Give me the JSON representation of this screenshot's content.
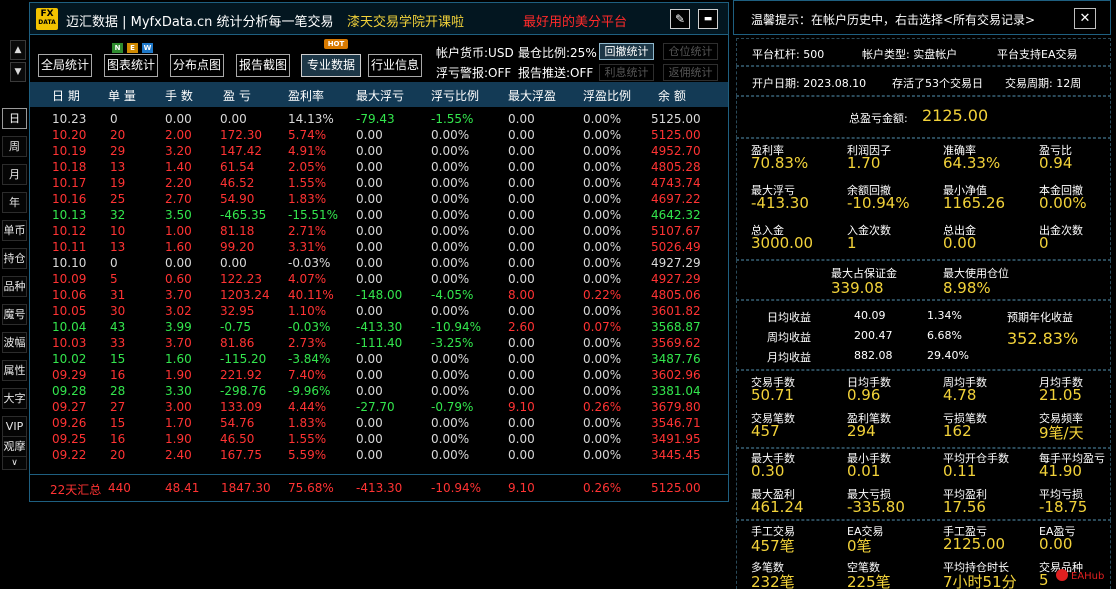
{
  "left_strip": {
    "up_arrow": "▲",
    "down_arrow": "▼",
    "buttons": [
      "日",
      "周",
      "月",
      "年",
      "单币",
      "持仓",
      "品种",
      "魔号",
      "波幅",
      "属性",
      "大字",
      "VIP",
      "观摩"
    ],
    "chevron": "∨",
    "selected": "日"
  },
  "app": {
    "logo_top": "FX",
    "logo_bottom": "DATA",
    "title": "迈汇数据 | MyfxData.cn  统计分析每一笔交易",
    "promo1": "漆天交易学院开课啦",
    "promo2": "最好用的美分平台",
    "edit_icon": "✎",
    "minimize_icon": "▬"
  },
  "toolbar": {
    "badge_new": [
      "N",
      "E",
      "W"
    ],
    "badge_new_colors": [
      "#2e8b2e",
      "#d08a00",
      "#1d77c8"
    ],
    "badge_hot": "HOT",
    "buttons": [
      "全局统计",
      "图表统计",
      "分布点图",
      "报告截图",
      "专业数据",
      "行业信息"
    ],
    "active": "专业数据",
    "currency": "帐户货币:USD",
    "max_position_ratio": "最仓比例:25%",
    "float_alert": "浮亏警报:OFF",
    "report_push": "报告推送:OFF",
    "small_buttons": [
      "回撤统计",
      "仓位统计",
      "利息统计",
      "返佣统计"
    ]
  },
  "table": {
    "headers": [
      "日 期",
      "单 量",
      "手 数",
      "盈 亏",
      "盈利率",
      "最大浮亏",
      "浮亏比例",
      "最大浮盈",
      "浮盈比例",
      "余 额"
    ],
    "rows": [
      [
        "10.23",
        "0",
        "0.00",
        "0.00",
        "14.13%",
        "-79.43",
        "-1.55%",
        "0.00",
        "0.00%",
        "5125.00"
      ],
      [
        "10.20",
        "20",
        "2.00",
        "172.30",
        "5.74%",
        "0.00",
        "0.00%",
        "0.00",
        "0.00%",
        "5125.00"
      ],
      [
        "10.19",
        "29",
        "3.20",
        "147.42",
        "4.91%",
        "0.00",
        "0.00%",
        "0.00",
        "0.00%",
        "4952.70"
      ],
      [
        "10.18",
        "13",
        "1.40",
        "61.54",
        "2.05%",
        "0.00",
        "0.00%",
        "0.00",
        "0.00%",
        "4805.28"
      ],
      [
        "10.17",
        "19",
        "2.20",
        "46.52",
        "1.55%",
        "0.00",
        "0.00%",
        "0.00",
        "0.00%",
        "4743.74"
      ],
      [
        "10.16",
        "25",
        "2.70",
        "54.90",
        "1.83%",
        "0.00",
        "0.00%",
        "0.00",
        "0.00%",
        "4697.22"
      ],
      [
        "10.13",
        "32",
        "3.50",
        "-465.35",
        "-15.51%",
        "0.00",
        "0.00%",
        "0.00",
        "0.00%",
        "4642.32"
      ],
      [
        "10.12",
        "10",
        "1.00",
        "81.18",
        "2.71%",
        "0.00",
        "0.00%",
        "0.00",
        "0.00%",
        "5107.67"
      ],
      [
        "10.11",
        "13",
        "1.60",
        "99.20",
        "3.31%",
        "0.00",
        "0.00%",
        "0.00",
        "0.00%",
        "5026.49"
      ],
      [
        "10.10",
        "0",
        "0.00",
        "0.00",
        "-0.03%",
        "0.00",
        "0.00%",
        "0.00",
        "0.00%",
        "4927.29"
      ],
      [
        "10.09",
        "5",
        "0.60",
        "122.23",
        "4.07%",
        "0.00",
        "0.00%",
        "0.00",
        "0.00%",
        "4927.29"
      ],
      [
        "10.06",
        "31",
        "3.70",
        "1203.24",
        "40.11%",
        "-148.00",
        "-4.05%",
        "8.00",
        "0.22%",
        "4805.06"
      ],
      [
        "10.05",
        "30",
        "3.02",
        "32.95",
        "1.10%",
        "0.00",
        "0.00%",
        "0.00",
        "0.00%",
        "3601.82"
      ],
      [
        "10.04",
        "43",
        "3.99",
        "-0.75",
        "-0.03%",
        "-413.30",
        "-10.94%",
        "2.60",
        "0.07%",
        "3568.87"
      ],
      [
        "10.03",
        "33",
        "3.70",
        "81.86",
        "2.73%",
        "-111.40",
        "-3.25%",
        "0.00",
        "0.00%",
        "3569.62"
      ],
      [
        "10.02",
        "15",
        "1.60",
        "-115.20",
        "-3.84%",
        "0.00",
        "0.00%",
        "0.00",
        "0.00%",
        "3487.76"
      ],
      [
        "09.29",
        "16",
        "1.90",
        "221.92",
        "7.40%",
        "0.00",
        "0.00%",
        "0.00",
        "0.00%",
        "3602.96"
      ],
      [
        "09.28",
        "28",
        "3.30",
        "-298.76",
        "-9.96%",
        "0.00",
        "0.00%",
        "0.00",
        "0.00%",
        "3381.04"
      ],
      [
        "09.27",
        "27",
        "3.00",
        "133.09",
        "4.44%",
        "-27.70",
        "-0.79%",
        "9.10",
        "0.26%",
        "3679.80"
      ],
      [
        "09.26",
        "15",
        "1.70",
        "54.76",
        "1.83%",
        "0.00",
        "0.00%",
        "0.00",
        "0.00%",
        "3546.71"
      ],
      [
        "09.25",
        "16",
        "1.90",
        "46.50",
        "1.55%",
        "0.00",
        "0.00%",
        "0.00",
        "0.00%",
        "3491.95"
      ],
      [
        "09.22",
        "20",
        "2.40",
        "167.75",
        "5.59%",
        "0.00",
        "0.00%",
        "0.00",
        "0.00%",
        "3445.45"
      ]
    ],
    "row_colors": [
      "#d9d9d9",
      "#ff3333",
      "#ff3333",
      "#ff3333",
      "#ff3333",
      "#ff3333",
      "#33e64d",
      "#ff3333",
      "#ff3333",
      "#d9d9d9",
      "#ff3333",
      "#ff3333",
      "#ff3333",
      "#33e64d",
      "#ff3333",
      "#33e64d",
      "#ff3333",
      "#33e64d",
      "#ff3333",
      "#ff3333",
      "#ff3333",
      "#ff3333"
    ],
    "summary": [
      "22天汇总",
      "440",
      "48.41",
      "1847.30",
      "75.68%",
      "-413.30",
      "-10.94%",
      "9.10",
      "0.26%",
      "5125.00"
    ]
  },
  "colors": {
    "profit": "#ff3333",
    "loss": "#33e64d",
    "neutral": "#d9d9d9",
    "accent": "#f2d23a",
    "zero": "#d9d9d9",
    "max_float_loss": "#33e64d"
  },
  "right": {
    "notice": "温馨提示：在帐户历史中，右击选择<所有交易记录>",
    "close_icon": "✕",
    "account": {
      "leverage": "平台杠杆:  500",
      "type": "帐户类型:  实盘帐户",
      "ea": "平台支持EA交易",
      "open_date": "开户日期:  2023.08.10",
      "days": "存活了53个交易日",
      "cycle": "交易周期:  12周"
    },
    "total_label": "总盈亏金额:",
    "total_value": "2125.00",
    "stats1": [
      {
        "label": "盈利率",
        "value": "70.83%"
      },
      {
        "label": "利润因子",
        "value": "1.70"
      },
      {
        "label": "准确率",
        "value": "64.33%"
      },
      {
        "label": "盈亏比",
        "value": "0.94"
      },
      {
        "label": "最大浮亏",
        "value": "-413.30"
      },
      {
        "label": "余额回撤",
        "value": "-10.94%"
      },
      {
        "label": "最小净值",
        "value": "1165.26"
      },
      {
        "label": "本金回撤",
        "value": "0.00%"
      },
      {
        "label": "总入金",
        "value": "3000.00"
      },
      {
        "label": "入金次数",
        "value": "1"
      },
      {
        "label": "总出金",
        "value": "0.00"
      },
      {
        "label": "出金次数",
        "value": "0"
      }
    ],
    "margin": [
      {
        "label": "最大占保证金",
        "value": "339.08"
      },
      {
        "label": "最大使用仓位",
        "value": "8.98%"
      }
    ],
    "avg": [
      {
        "label": "日均收益",
        "amount": "40.09",
        "pct": "1.34%"
      },
      {
        "label": "周均收益",
        "amount": "200.47",
        "pct": "6.68%"
      },
      {
        "label": "月均收益",
        "amount": "882.08",
        "pct": "29.40%"
      }
    ],
    "annual_label": "预期年化收益",
    "annual_value": "352.83%",
    "stats2": [
      {
        "label": "交易手数",
        "value": "50.71"
      },
      {
        "label": "日均手数",
        "value": "0.96"
      },
      {
        "label": "周均手数",
        "value": "4.78"
      },
      {
        "label": "月均手数",
        "value": "21.05"
      },
      {
        "label": "交易笔数",
        "value": "457"
      },
      {
        "label": "盈利笔数",
        "value": "294"
      },
      {
        "label": "亏损笔数",
        "value": "162"
      },
      {
        "label": "交易频率",
        "value": "9笔/天"
      }
    ],
    "stats3": [
      {
        "label": "最大手数",
        "value": "0.30"
      },
      {
        "label": "最小手数",
        "value": "0.01"
      },
      {
        "label": "平均开仓手数",
        "value": "0.11"
      },
      {
        "label": "每手平均盈亏",
        "value": "41.90"
      },
      {
        "label": "最大盈利",
        "value": "461.24"
      },
      {
        "label": "最大亏损",
        "value": "-335.80"
      },
      {
        "label": "平均盈利",
        "value": "17.56"
      },
      {
        "label": "平均亏损",
        "value": "-18.75"
      }
    ],
    "stats4": [
      {
        "label": "手工交易",
        "value": "457笔"
      },
      {
        "label": "EA交易",
        "value": "0笔"
      },
      {
        "label": "手工盈亏",
        "value": "2125.00"
      },
      {
        "label": "EA盈亏",
        "value": "0.00"
      },
      {
        "label": "多笔数",
        "value": "232笔"
      },
      {
        "label": "空笔数",
        "value": "225笔"
      },
      {
        "label": "平均持仓时长",
        "value": "7小时51分"
      },
      {
        "label": "交易品种",
        "value": "5"
      }
    ],
    "watermark": "EAHub"
  }
}
